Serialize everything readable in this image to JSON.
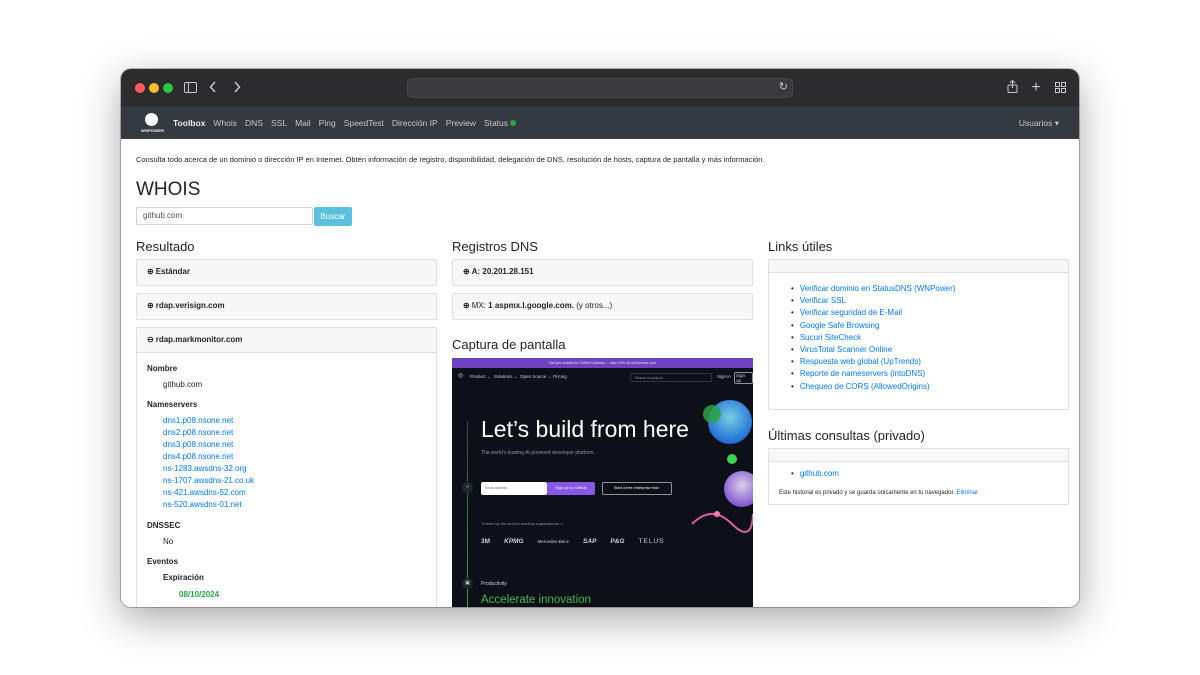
{
  "navbar": {
    "logo_text": "WNPOWER",
    "items": [
      "Toolbox",
      "Whois",
      "DNS",
      "SSL",
      "Mail",
      "Ping",
      "SpeedTest",
      "Dirección IP",
      "Preview",
      "Status"
    ],
    "user_menu": "Usuarios ▾"
  },
  "intro": "Consulta todo acerca de un dominio o dirección IP en Internet. Obtén información de registro, disponibilidad, delegación de DNS, resolución de hosts, captura de pantalla y más información.",
  "whois": {
    "title": "WHOIS",
    "query": "github.com",
    "button": "Buscar"
  },
  "resultado": {
    "title": "Resultado",
    "cards": [
      {
        "symbol": "⊕",
        "label": "Estándar"
      },
      {
        "symbol": "⊕",
        "label": "rdap.verisign.com"
      },
      {
        "symbol": "⊖",
        "label": "rdap.markmonitor.com"
      }
    ],
    "nombre_label": "Nombre",
    "nombre_value": "github.com",
    "nameservers_label": "Nameservers",
    "nameservers": [
      "dns1.p08.nsone.net",
      "dns2.p08.nsone.net",
      "dns3.p08.nsone.net",
      "dns4.p08.nsone.net",
      "ns-1283.awsdns-32.org",
      "ns-1707.awsdns-21.co.uk",
      "ns-421.awsdns-52.com",
      "ns-520.awsdns-01.net"
    ],
    "dnssec_label": "DNSSEC",
    "dnssec_value": "No",
    "eventos_label": "Eventos",
    "expiracion_label": "Expiración",
    "expiracion_value": "08/10/2024"
  },
  "registros": {
    "title": "Registros DNS",
    "a_prefix": "A: ",
    "a_value": "20.201.28.151",
    "mx_prefix": "MX: ",
    "mx_value": "1 aspmx.l.google.com.",
    "mx_more": " (y otros...)"
  },
  "captura": {
    "title": "Captura de pantalla",
    "banner": "Get your tickets for GitHub Universe — take 10% off at Universe.com",
    "gh_nav": [
      "Product ⌄",
      "Solutions ⌄",
      "Open Source ⌄",
      "Pricing"
    ],
    "gh_search": "Search or jump to...",
    "gh_signin": "Sign in",
    "gh_signup": "Sign up",
    "hero": "Let’s build from here",
    "sub": "The world’s leading AI-powered developer platform.",
    "email_placeholder": "Email address",
    "signup_btn": "Sign up for GitHub",
    "enterprise_btn": "Start a free enterprise trial ›",
    "trusted": "Trusted by the world’s leading organizations ↘",
    "logos": [
      "3M",
      "KPMG",
      "Mercedes-Benz",
      "SAP",
      "P&G",
      "TELUS"
    ],
    "productivity": "Productivity",
    "accelerate": "Accelerate innovation"
  },
  "links": {
    "title": "Links útiles",
    "items": [
      "Verificar dominio en StatusDNS (WNPower)",
      "Verificar SSL",
      "Verificar seguridad de E-Mail",
      "Google Safe Browsing",
      "Sucuri SiteCheck",
      "VirusTotal Scanner Online",
      "Respuesta web global (UpTrends)",
      "Reporte de nameservers (intoDNS)",
      "Chequeo de CORS (AllowedOrigins)"
    ]
  },
  "ultimas": {
    "title": "Últimas consultas (privado)",
    "item": "github.com",
    "note": "Este historial es privado y se guarda únicamente en tu navegador. ",
    "note_link": "Eliminar"
  },
  "colors": {
    "accent": "#5bc0de",
    "link": "#007bff",
    "navbar": "#343a40",
    "status": "#28a745"
  }
}
